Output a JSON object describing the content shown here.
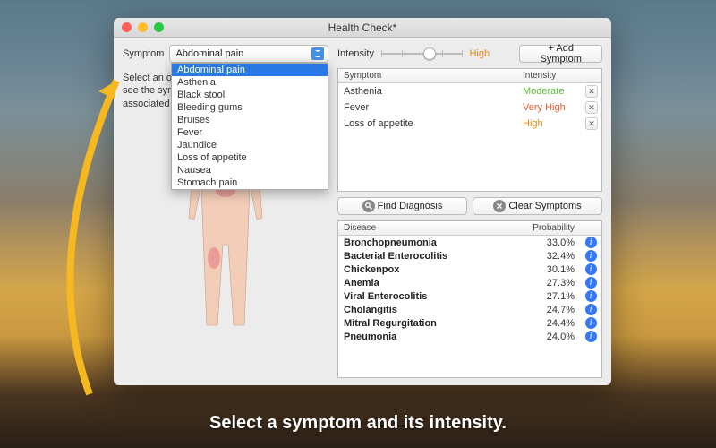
{
  "window": {
    "title": "Health Check*"
  },
  "symptom": {
    "label": "Symptom",
    "selected": "Abdominal pain",
    "options": [
      "Abdominal pain",
      "Asthenia",
      "Black stool",
      "Bleeding gums",
      "Bruises",
      "Fever",
      "Jaundice",
      "Loss of appetite",
      "Nausea",
      "Stomach pain"
    ]
  },
  "hint": "Select an organ to see the symptoms associated",
  "intensity": {
    "label": "Intensity",
    "value": "High"
  },
  "add_button": "+ Add Symptom",
  "symptoms_table": {
    "headers": {
      "symptom": "Symptom",
      "intensity": "Intensity"
    },
    "rows": [
      {
        "name": "Asthenia",
        "intensity": "Moderate",
        "class": "c-moderate"
      },
      {
        "name": "Fever",
        "intensity": "Very High",
        "class": "c-veryhigh"
      },
      {
        "name": "Loss of appetite",
        "intensity": "High",
        "class": "c-high"
      }
    ]
  },
  "actions": {
    "find": "Find Diagnosis",
    "clear": "Clear Symptoms"
  },
  "diagnosis_table": {
    "headers": {
      "disease": "Disease",
      "probability": "Probability"
    },
    "rows": [
      {
        "name": "Bronchopneumonia",
        "prob": "33.0%"
      },
      {
        "name": "Bacterial Enterocolitis",
        "prob": "32.4%"
      },
      {
        "name": "Chickenpox",
        "prob": "30.1%"
      },
      {
        "name": "Anemia",
        "prob": "27.3%"
      },
      {
        "name": "Viral Enterocolitis",
        "prob": "27.1%"
      },
      {
        "name": "Cholangitis",
        "prob": "24.7%"
      },
      {
        "name": "Mitral Regurgitation",
        "prob": "24.4%"
      },
      {
        "name": "Pneumonia",
        "prob": "24.0%"
      }
    ]
  },
  "caption": "Select a symptom and its intensity."
}
